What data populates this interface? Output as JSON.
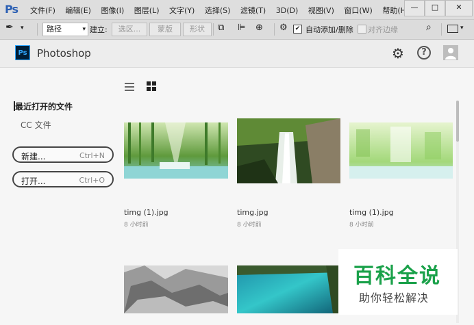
{
  "app": {
    "logo": "Ps",
    "title": "Photoshop"
  },
  "menu": [
    "文件(F)",
    "编辑(E)",
    "图像(I)",
    "图层(L)",
    "文字(Y)",
    "选择(S)",
    "滤镜(T)",
    "3D(D)",
    "视图(V)",
    "窗口(W)",
    "帮助(H)"
  ],
  "window_controls": {
    "minimize": "—",
    "maximize": "□",
    "close": "✕"
  },
  "toolbar": {
    "mode_value": "路径",
    "create_label": "建立:",
    "selection_btn": "选区...",
    "mask_btn": "蒙版",
    "shape_btn": "形状",
    "auto_add_delete": "自动添加/删除",
    "align_edges": "对齐边缘",
    "auto_add_checked": true,
    "align_edges_checked": false
  },
  "sidebar": {
    "recent_label": "最近打开的文件",
    "cc_files": "CC 文件",
    "new_label": "新建...",
    "new_shortcut": "Ctrl+N",
    "open_label": "打开...",
    "open_shortcut": "Ctrl+O"
  },
  "files": [
    {
      "name": "timg (1).jpg",
      "time": "8 小时前"
    },
    {
      "name": "timg.jpg",
      "time": "8 小时前"
    },
    {
      "name": "timg (1).jpg",
      "time": "8 小时前"
    }
  ],
  "watermark": {
    "main": "百科全说",
    "sub": "助你轻松解决"
  },
  "colors": {
    "ps_blue": "#31a8ff",
    "ps_dark": "#001e36",
    "watermark_green": "#1aa14a"
  }
}
